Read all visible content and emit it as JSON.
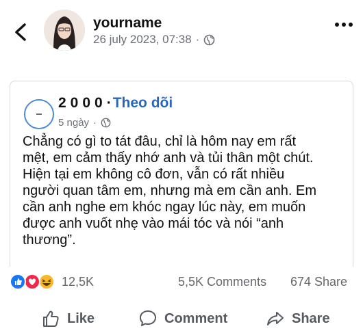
{
  "header": {
    "user_name": "yourname",
    "timestamp": "26 july 2023, 07:38",
    "separator": "·",
    "audience_icon": "globe-icon",
    "back_icon": "chevron-left-icon",
    "more_icon": "more-horizontal-icon"
  },
  "shared_post": {
    "page_name": "2000",
    "separator": "·",
    "follow_label": "Theo dõi",
    "time": "5 ngày",
    "meta_separator": "·",
    "audience_icon": "globe-icon",
    "text_lines": [
      "Chẳng có gì to tát đâu, chỉ là hôm nay em rất",
      "mệt, em cảm thấy nhớ anh và tủi thân một chút.",
      "Hiện tại em không cô đơn, vẫn có rất nhiều",
      "người quan tâm em, nhưng mà em cần anh. Em",
      "cần anh nghe em khóc ngay lúc này, em muốn",
      "được anh vuốt nhẹ vào mái tóc và nói “anh",
      "thương”."
    ]
  },
  "stats": {
    "reactions_count": "12,5K",
    "comments": "5,5K Comments",
    "shares": "674 Share",
    "reaction_icons": [
      "like-reaction-icon",
      "love-reaction-icon",
      "haha-reaction-icon"
    ]
  },
  "actions": {
    "like_label": "Like",
    "comment_label": "Comment",
    "share_label": "Share"
  },
  "colors": {
    "follow": "#2a67b8",
    "like": "#1877f2",
    "love": "#f0284a",
    "haha": "#f7b928",
    "muted": "#65676b"
  }
}
